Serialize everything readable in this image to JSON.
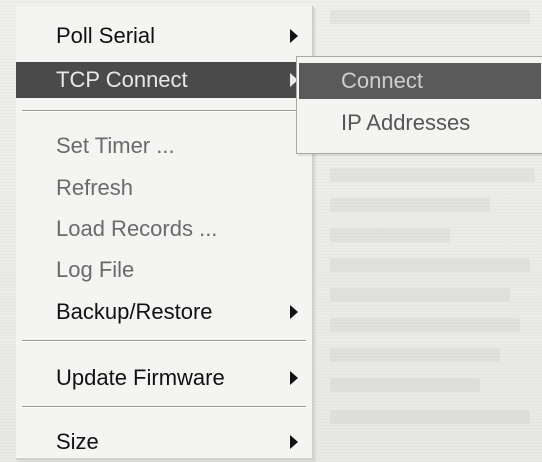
{
  "menu": {
    "items": [
      {
        "label": "Poll Serial",
        "has_submenu": true,
        "state": "normal"
      },
      {
        "label": "TCP Connect",
        "has_submenu": true,
        "state": "highlighted"
      },
      {
        "label": "Set Timer ...",
        "has_submenu": false,
        "state": "disabled"
      },
      {
        "label": "Refresh",
        "has_submenu": false,
        "state": "disabled"
      },
      {
        "label": "Load Records ...",
        "has_submenu": false,
        "state": "disabled"
      },
      {
        "label": "Log File",
        "has_submenu": false,
        "state": "disabled"
      },
      {
        "label": "Backup/Restore",
        "has_submenu": true,
        "state": "normal"
      },
      {
        "label": "Update Firmware",
        "has_submenu": true,
        "state": "normal"
      },
      {
        "label": "Size",
        "has_submenu": true,
        "state": "normal"
      }
    ]
  },
  "submenu": {
    "items": [
      {
        "label": "Connect",
        "state": "highlighted"
      },
      {
        "label": "IP Addresses",
        "state": "normal"
      }
    ]
  },
  "colors": {
    "highlight": "#4a4a4a",
    "menu_bg": "#f4f4f2",
    "disabled_text": "#6a6a6a"
  },
  "icons": [
    "submenu-arrow-icon"
  ]
}
